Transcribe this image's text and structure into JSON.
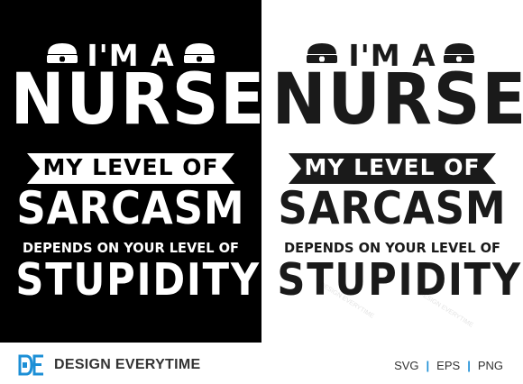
{
  "design": {
    "line1": "I'M A",
    "line2": "NURSE",
    "line3": "MY LEVEL OF",
    "line4": "SARCASM",
    "line5": "DEPENDS ON YOUR LEVEL OF",
    "line6": "STUPIDITY"
  },
  "footer": {
    "brand_name": "DESIGN EVERYTIME",
    "formats": [
      "SVG",
      "EPS",
      "PNG"
    ]
  },
  "watermark": "DESIGN EVERYTIME",
  "colors": {
    "dark_bg": "#000000",
    "dark_text": "#ffffff",
    "light_bg": "#ffffff",
    "light_text": "#1a1a1a",
    "accent": "#1c8fd6"
  },
  "icons": [
    "nurse-cap-icon",
    "design-everytime-logo"
  ]
}
